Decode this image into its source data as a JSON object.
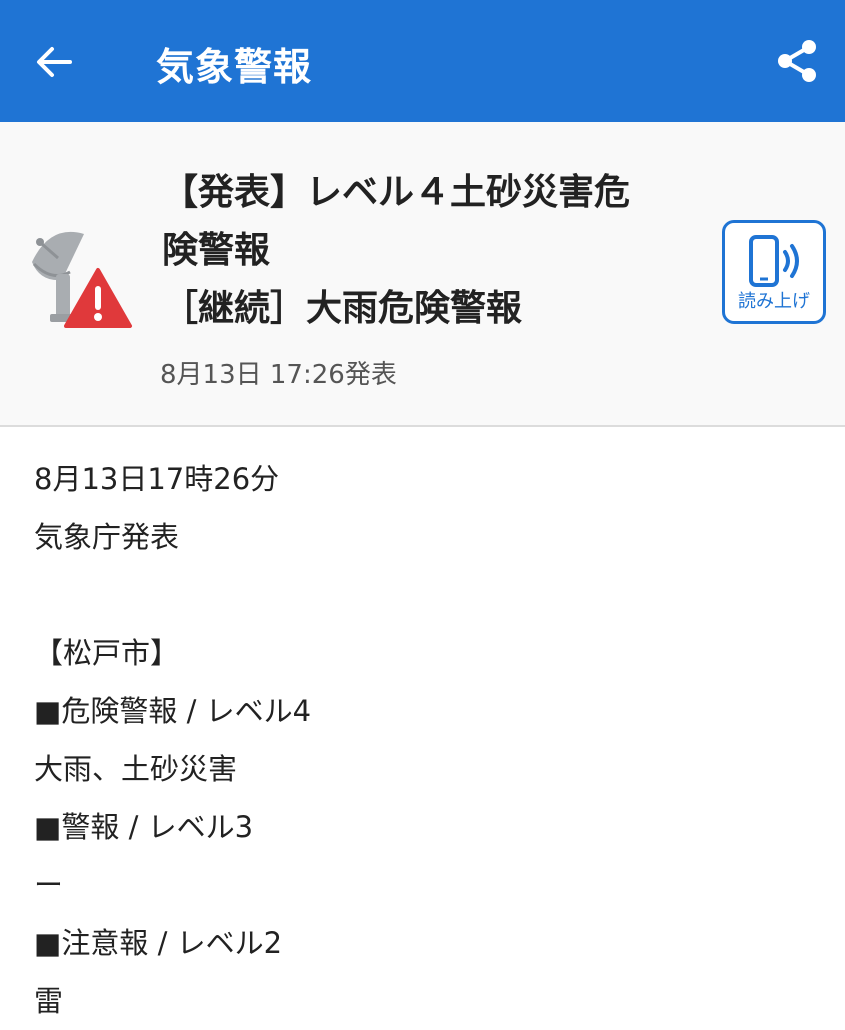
{
  "appbar": {
    "title": "気象警報",
    "back_icon": "arrow-left-icon",
    "share_icon": "share-icon",
    "background": "#1f74d4"
  },
  "header": {
    "icon": "satellite-warning-icon",
    "headline_lines": [
      "【発表】レベル４土砂災害危",
      "険警報",
      "［継続］大雨危険警報"
    ],
    "published": "8月13日 17:26発表",
    "read_aloud_label": "読み上げ",
    "read_aloud_icon": "phone-speaker-icon"
  },
  "body": {
    "lines": [
      "8月13日17時26分",
      "気象庁発表",
      "",
      "【松戸市】",
      "■危険警報 / レベル4",
      "大雨、土砂災害",
      "■警報 / レベル3",
      "ー",
      "■注意報 / レベル2",
      "雷"
    ]
  }
}
